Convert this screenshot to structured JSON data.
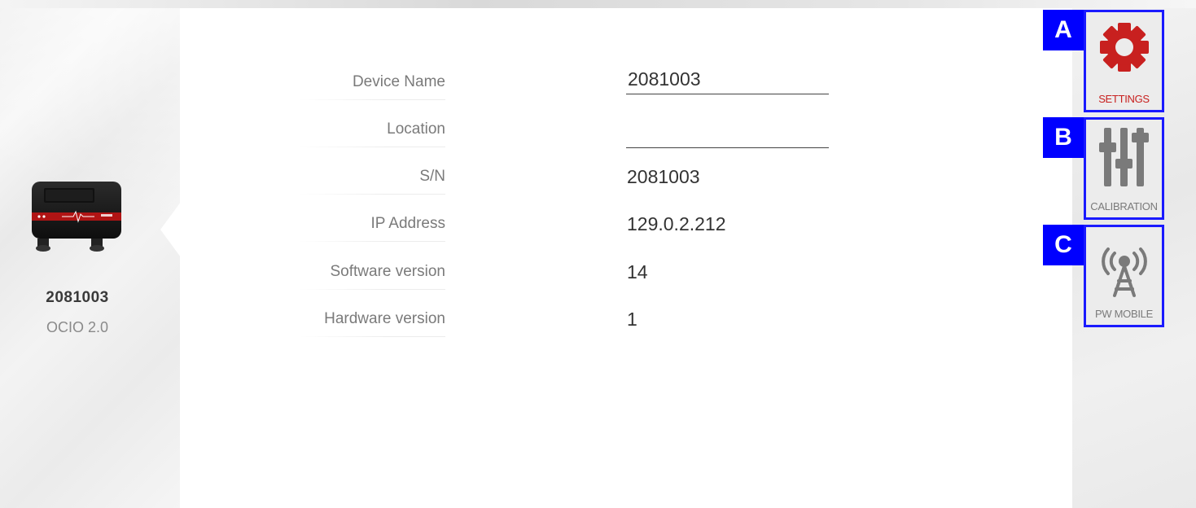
{
  "device": {
    "id": "2081003",
    "model": "OCIO 2.0"
  },
  "info": {
    "rows": [
      {
        "label": "Device Name",
        "value": "2081003",
        "editable": true
      },
      {
        "label": "Location",
        "value": "",
        "editable": true
      },
      {
        "label": "S/N",
        "value": "2081003",
        "editable": false
      },
      {
        "label": "IP Address",
        "value": "129.0.2.212",
        "editable": false
      },
      {
        "label": "Software version",
        "value": "14",
        "editable": false
      },
      {
        "label": "Hardware version",
        "value": "1",
        "editable": false
      }
    ]
  },
  "tools": {
    "settings": {
      "key": "A",
      "label": "SETTINGS",
      "icon": "gear-icon",
      "color": "#c8201f"
    },
    "calibration": {
      "key": "B",
      "label": "CALIBRATION",
      "icon": "sliders-icon",
      "color": "#7a7a7a"
    },
    "mobile": {
      "key": "C",
      "label": "PW MOBILE",
      "icon": "antenna-tower-icon",
      "color": "#7a7a7a"
    }
  },
  "colors": {
    "accent": "#c8201f",
    "highlight_border": "#1a1aff",
    "badge": "#0000ff"
  }
}
